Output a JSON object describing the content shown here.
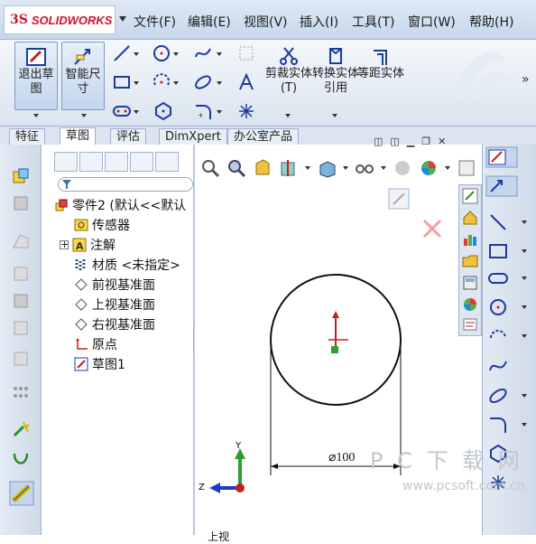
{
  "app": {
    "logo_ds": "3S",
    "logo_name": "SOLIDWORKS"
  },
  "menu": [
    "文件(F)",
    "编辑(E)",
    "视图(V)",
    "插入(I)",
    "工具(T)",
    "窗口(W)",
    "帮助(H)"
  ],
  "command_manager": {
    "exit_sketch": "退出草图",
    "smart_dimension": "智能尺寸",
    "trim_entities": "剪裁实体(T)",
    "convert_entities": "转换实体引用",
    "offset_entities": "等距实体",
    "more": "»"
  },
  "tabs": [
    "特征",
    "草图",
    "评估",
    "DimXpert",
    "办公室产品"
  ],
  "active_tab": "草图",
  "feature_tree": {
    "root": "零件2 (默认<<默认",
    "items": [
      "传感器",
      "注解",
      "材质 <未指定>",
      "前视基准面",
      "上视基准面",
      "右视基准面",
      "原点",
      "草图1"
    ]
  },
  "drawing": {
    "dimension": "⌀100",
    "axis_y": "Y",
    "axis_z": "Z"
  },
  "watermark": {
    "main": "P C 下 载 网",
    "url": "www.pcsoft.com.cn"
  },
  "bottom_label": "上视",
  "colors": {
    "accent_red": "#d0112b",
    "sketch_blue": "#1a3c9e",
    "toolbar_bg": "#dbe4ef"
  }
}
